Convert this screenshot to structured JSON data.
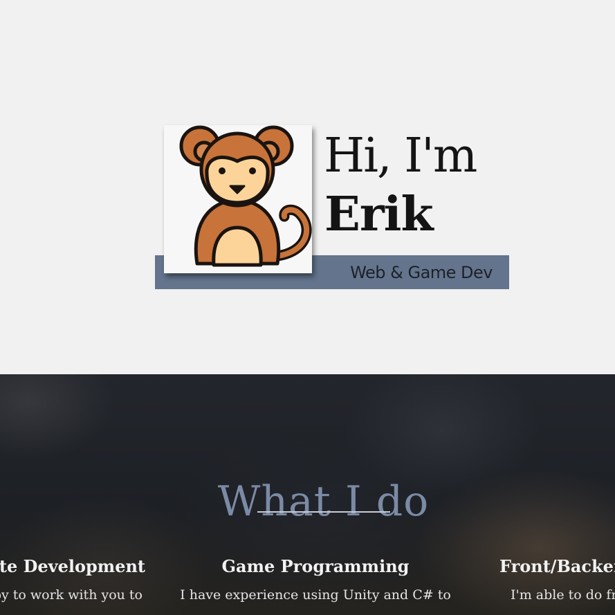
{
  "hero": {
    "greeting": "Hi, I'm",
    "name": "Erik",
    "subtitle": "Web & Game Dev",
    "band_color": "#64748d",
    "avatar_icon": "monkey-icon"
  },
  "services": {
    "title": "What I do",
    "title_color": "#7b8aa5",
    "items": [
      {
        "heading": "site Development",
        "text": "ppy to work with you to"
      },
      {
        "heading": "Game Programming",
        "text": "I have experience using Unity and C# to"
      },
      {
        "heading": "Front/Backen",
        "text": "I'm able to do fro"
      }
    ]
  }
}
